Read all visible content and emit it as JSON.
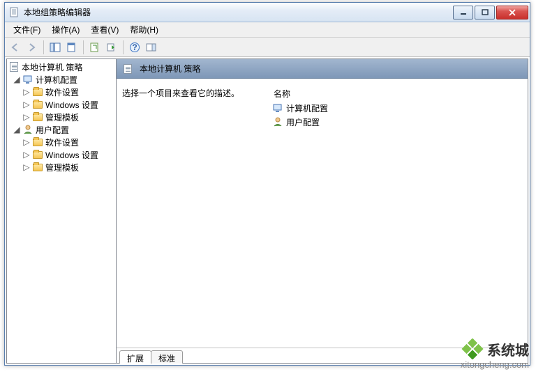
{
  "window": {
    "title": "本地组策略编辑器"
  },
  "menubar": {
    "file": "文件(F)",
    "action": "操作(A)",
    "view": "查看(V)",
    "help": "帮助(H)"
  },
  "tree": {
    "root": "本地计算机 策略",
    "computer": {
      "label": "计算机配置",
      "software": "软件设置",
      "windows": "Windows 设置",
      "templates": "管理模板"
    },
    "user": {
      "label": "用户配置",
      "software": "软件设置",
      "windows": "Windows 设置",
      "templates": "管理模板"
    }
  },
  "detail": {
    "header": "本地计算机 策略",
    "hint": "选择一个项目来查看它的描述。",
    "column_name": "名称",
    "items": {
      "computer": "计算机配置",
      "user": "用户配置"
    }
  },
  "tabs": {
    "extended": "扩展",
    "standard": "标准"
  },
  "watermark": {
    "brand": "系统城",
    "url": "xitongcheng.com"
  }
}
